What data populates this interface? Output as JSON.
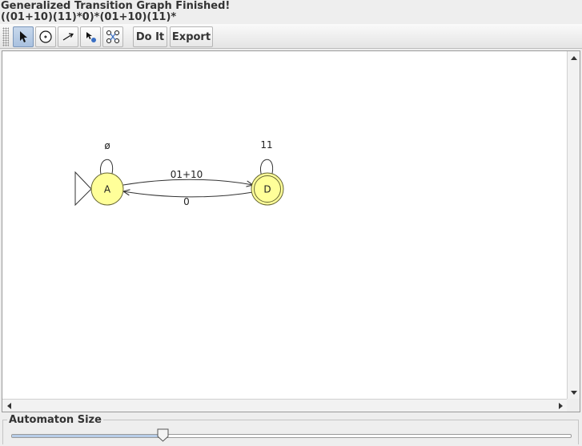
{
  "status": {
    "title": "Generalized Transition Graph Finished!",
    "regex": "((01+10)(11)*0)*(01+10)(11)*"
  },
  "toolbar": {
    "tools": [
      {
        "name": "attribute-editor",
        "icon": "pointer-arrow-icon",
        "selected": true
      },
      {
        "name": "state-creator",
        "icon": "state-circle-icon",
        "selected": false
      },
      {
        "name": "transition-creator",
        "icon": "transition-arrow-icon",
        "selected": false
      },
      {
        "name": "deleter",
        "icon": "delete-icon",
        "selected": false
      },
      {
        "name": "state-collapser",
        "icon": "collapse-states-icon",
        "selected": false
      }
    ],
    "do_it_label": "Do It",
    "export_label": "Export"
  },
  "automaton": {
    "states": [
      {
        "id": "A",
        "label": "A",
        "initial": true,
        "final": false
      },
      {
        "id": "D",
        "label": "D",
        "initial": false,
        "final": true
      }
    ],
    "transitions": [
      {
        "from": "A",
        "to": "A",
        "label": "ø"
      },
      {
        "from": "A",
        "to": "D",
        "label": "01+10"
      },
      {
        "from": "D",
        "to": "A",
        "label": "0"
      },
      {
        "from": "D",
        "to": "D",
        "label": "11"
      }
    ],
    "state_fill": "#ffff99",
    "state_stroke": "#666633"
  },
  "size_panel": {
    "label": "Automaton Size",
    "value_fraction": 0.27
  }
}
